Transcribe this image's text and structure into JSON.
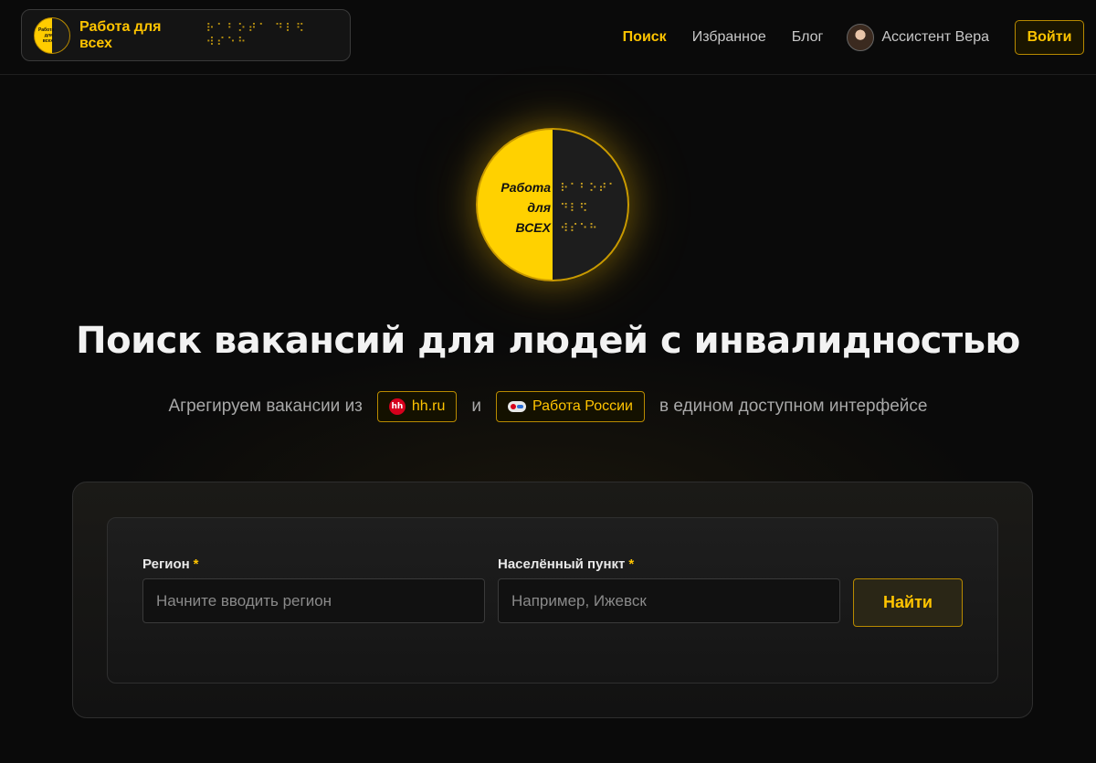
{
  "header": {
    "brand_name": "Работа для всех",
    "brand_braille": "⠗⠁⠃⠕⠞⠁ ⠙⠇⠫ ⠺⠎⠑⠓",
    "brand_logo_text": "Работа для всех",
    "nav": [
      {
        "label": "Поиск",
        "active": true
      },
      {
        "label": "Избранное",
        "active": false
      },
      {
        "label": "Блог",
        "active": false
      }
    ],
    "assistant_label": "Ассистент Вера",
    "login_label": "Войти"
  },
  "hero": {
    "logo_line1": "Работа",
    "logo_line2": "для",
    "logo_line3": "ВСЕХ",
    "logo_braille1": "⠗⠁⠃⠕⠞⠁",
    "logo_braille2": "⠙⠇⠫",
    "logo_braille3": "⠺⠎⠑⠓",
    "title": "Поиск вакансий для людей с инвалидностью",
    "sub_prefix": "Агрегируем вакансии из",
    "source1": "hh.ru",
    "source1_icon": "hh",
    "sub_and": "и",
    "source2": "Работа России",
    "sub_suffix": "в едином доступном интерфейсе"
  },
  "search": {
    "region_label": "Регион",
    "region_required": "*",
    "region_placeholder": "Начните вводить регион",
    "city_label": "Населённый пункт",
    "city_required": "*",
    "city_placeholder": "Например, Ижевск",
    "submit_label": "Найти"
  },
  "colors": {
    "accent": "#ffc400",
    "background": "#0a0a0a",
    "hh_red": "#d6001c"
  }
}
